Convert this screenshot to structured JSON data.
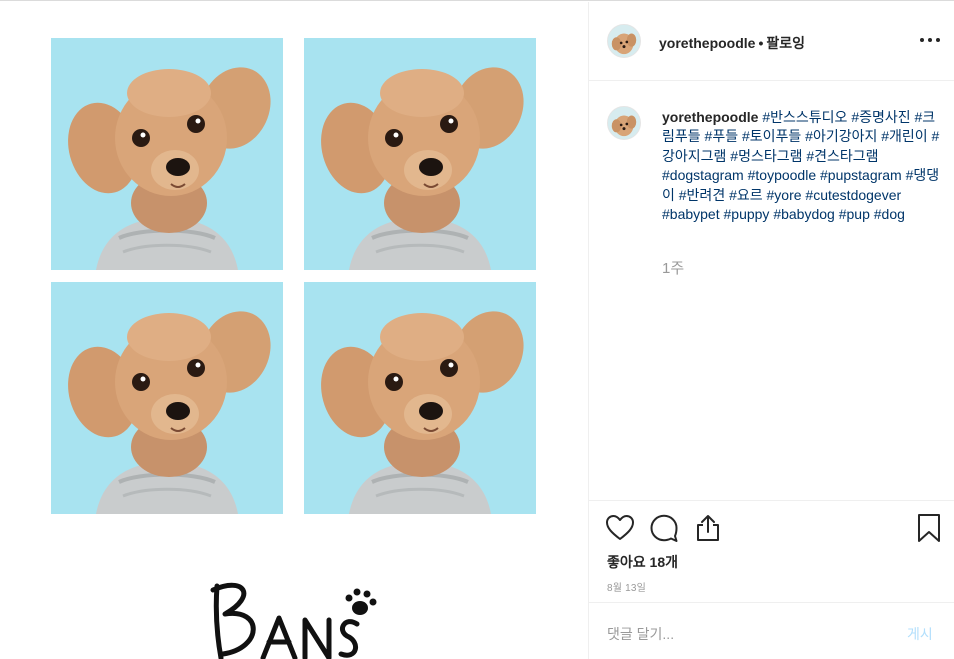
{
  "post": {
    "username": "yorethepoodle",
    "separator": "•",
    "follow_label": "팔로잉",
    "more_icon": "more-horizontal-icon"
  },
  "caption": {
    "username": "yorethepoodle",
    "hashtags": "#반스스튜디오 #증명사진 #크림푸들 #푸들 #토이푸들 #아기강아지 #개린이 #강아지그램 #멍스타그램 #견스타그램 #dogstagram #toypoodle #pupstagram #댕댕이 #반려견 #요르 #yore #cutestdogever #babypet #puppy #babydog #pup #dog",
    "time_ago": "1주"
  },
  "actions": {
    "icons": [
      "heart-icon",
      "comment-icon",
      "share-icon",
      "bookmark-icon"
    ],
    "likes_text": "좋아요 18개",
    "date_text": "8월 13일"
  },
  "comment": {
    "placeholder": "댓글 달기...",
    "post_label": "게시"
  },
  "media": {
    "logo_text": "BANS",
    "background_color": "#a8e3f0"
  },
  "colors": {
    "hashtag": "#003569",
    "muted": "#999999",
    "post_button": "#b2dffc"
  }
}
